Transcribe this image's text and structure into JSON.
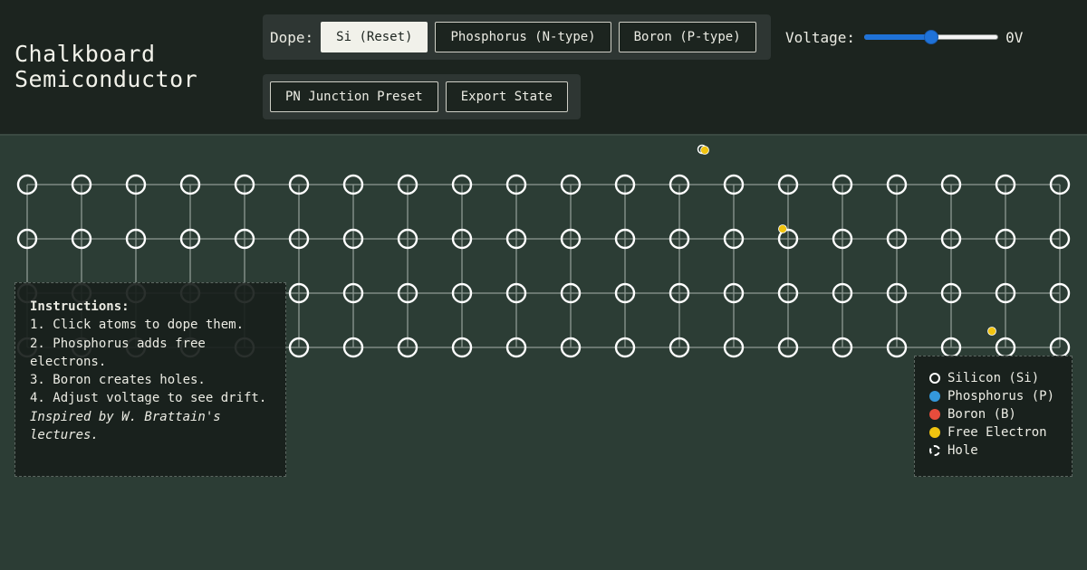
{
  "app": {
    "title_line1": "Chalkboard",
    "title_line2": "Semiconductor"
  },
  "dope": {
    "label": "Dope:",
    "buttons": [
      {
        "label": "Si (Reset)",
        "active": true
      },
      {
        "label": "Phosphorus (N-type)",
        "active": false
      },
      {
        "label": "Boron (P-type)",
        "active": false
      }
    ]
  },
  "actions": {
    "buttons": [
      {
        "label": "PN Junction Preset"
      },
      {
        "label": "Export State"
      }
    ]
  },
  "voltage": {
    "label": "Voltage:",
    "value": 0,
    "min": -10,
    "max": 10,
    "display": "0V"
  },
  "lattice": {
    "rows": 4,
    "cols": 20,
    "free_electrons": 4,
    "colors": {
      "bond": "#8e9a93",
      "silicon": "#ffffff",
      "electron": "#f1c40f"
    }
  },
  "instructions": {
    "title": "Instructions:",
    "steps": [
      "1. Click atoms to dope them.",
      "2. Phosphorus adds free electrons.",
      "3. Boron creates holes.",
      "4. Adjust voltage to see drift."
    ],
    "credit": "Inspired by W. Brattain's lectures."
  },
  "legend": {
    "items": [
      {
        "label": "Silicon (Si)",
        "icon": "silicon-swatch-icon",
        "color": "#ffffff"
      },
      {
        "label": "Phosphorus (P)",
        "icon": "phosphorus-swatch-icon",
        "color": "#3498db"
      },
      {
        "label": "Boron (B)",
        "icon": "boron-swatch-icon",
        "color": "#e74c3c"
      },
      {
        "label": "Free Electron",
        "icon": "electron-swatch-icon",
        "color": "#f1c40f"
      },
      {
        "label": "Hole",
        "icon": "hole-swatch-icon",
        "color": "#ffffff"
      }
    ]
  }
}
